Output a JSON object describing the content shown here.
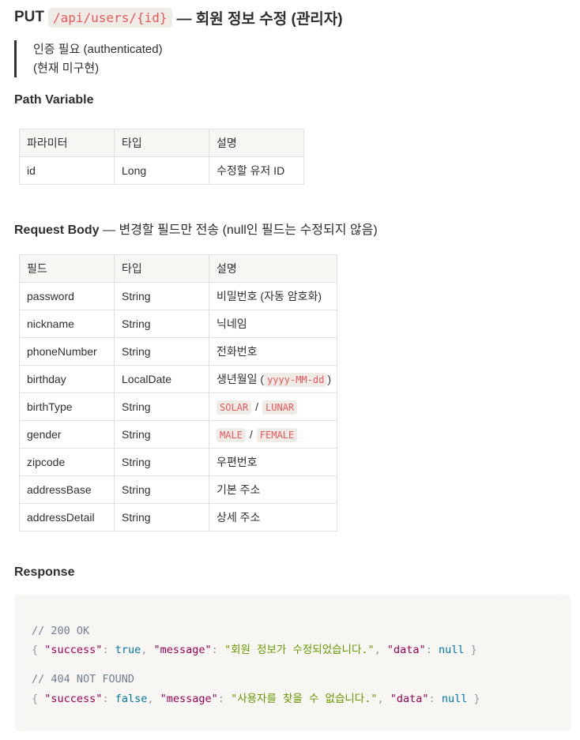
{
  "header": {
    "method": "PUT",
    "path": "/api/users/{id}",
    "title": "— 회원 정보 수정 (관리자)"
  },
  "note": {
    "line1": "인증 필요 (authenticated)",
    "line2": "(현재 미구현)"
  },
  "path_variable": {
    "heading": "Path Variable",
    "columns": [
      "파라미터",
      "타입",
      "설명"
    ],
    "rows": [
      {
        "name": "id",
        "type": "Long",
        "desc": "수정할 유저 ID"
      }
    ]
  },
  "request_body": {
    "heading": "Request Body",
    "subtitle": "— 변경할 필드만 전송 (null인 필드는 수정되지 않음)",
    "columns": [
      "필드",
      "타입",
      "설명"
    ],
    "rows": [
      {
        "name": "password",
        "type": "String",
        "desc": "비밀번호 (자동 암호화)"
      },
      {
        "name": "nickname",
        "type": "String",
        "desc": "닉네임"
      },
      {
        "name": "phoneNumber",
        "type": "String",
        "desc": "전화번호"
      },
      {
        "name": "birthday",
        "type": "LocalDate",
        "desc_prefix": "생년월일 (",
        "desc_code": "yyyy-MM-dd",
        "desc_suffix": ")"
      },
      {
        "name": "birthType",
        "type": "String",
        "desc_code1": "SOLAR",
        "desc_sep": "/",
        "desc_code2": "LUNAR"
      },
      {
        "name": "gender",
        "type": "String",
        "desc_code1": "MALE",
        "desc_sep": "/",
        "desc_code2": "FEMALE"
      },
      {
        "name": "zipcode",
        "type": "String",
        "desc": "우편번호"
      },
      {
        "name": "addressBase",
        "type": "String",
        "desc": "기본 주소"
      },
      {
        "name": "addressDetail",
        "type": "String",
        "desc": "상세 주소"
      }
    ]
  },
  "response": {
    "heading": "Response",
    "ok": {
      "comment": "// 200 OK",
      "brace_open": "{",
      "key_success": "\"success\"",
      "colon": ":",
      "val_success": "true",
      "comma": ",",
      "key_message": "\"message\"",
      "val_message": "\"회원 정보가 수정되었습니다.\"",
      "key_data": "\"data\"",
      "val_data": "null",
      "brace_close": "}"
    },
    "not_found": {
      "comment": "// 404 NOT FOUND",
      "brace_open": "{",
      "key_success": "\"success\"",
      "colon": ":",
      "val_success": "false",
      "comma": ",",
      "key_message": "\"message\"",
      "val_message": "\"사용자를 찾을 수 없습니다.\"",
      "key_data": "\"data\"",
      "val_data": "null",
      "brace_close": "}"
    }
  }
}
